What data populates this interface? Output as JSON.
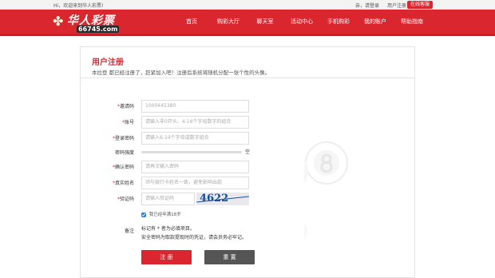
{
  "topbar": {
    "welcome": "Hi，欢迎来到华人彩票!",
    "login": "亲，请登录",
    "register": "用户注册",
    "service": "在线客服"
  },
  "logo": {
    "name": "华人彩票",
    "domain": "66745.com"
  },
  "nav": {
    "items": [
      {
        "label": "首页"
      },
      {
        "label": "购彩大厅"
      },
      {
        "label": "聊天室"
      },
      {
        "label": "活动中心"
      },
      {
        "label": "手机购彩"
      },
      {
        "label": "我的账户"
      },
      {
        "label": "帮助指南"
      }
    ]
  },
  "form": {
    "title": "用户注册",
    "intro": "本拉登 都已经注册了，赶紧加入吧！注册后系统将随机分配一张个性的头像。",
    "fields": {
      "referral": {
        "label": "邀请码",
        "value": "1000445380"
      },
      "account": {
        "label": "账号",
        "placeholder": "请输入非0开头、4-16个字母数字的组合"
      },
      "password": {
        "label": "登录密码",
        "placeholder": "请输入6-14个字母或数字组合"
      },
      "strength": {
        "label": "密码强度",
        "tip": "空"
      },
      "confirm": {
        "label": "确认密码",
        "placeholder": "请再次输入密码"
      },
      "realname": {
        "label": "真实姓名",
        "placeholder": "须与银行卡姓名一致，避免影响出款"
      },
      "captcha": {
        "label": "验证码",
        "placeholder": "请输入验证码",
        "code": "4622"
      }
    },
    "agree": "我已经年满18岁",
    "note_label": "备注",
    "notes": [
      "标记有 * 者为必填项目。",
      "安全密码为取款提现时的凭证，请会员务必牢记。"
    ],
    "submit": "注 册",
    "reset": "重 置"
  },
  "colors": {
    "brand": "#d9262f",
    "reset_btn": "#555555"
  }
}
